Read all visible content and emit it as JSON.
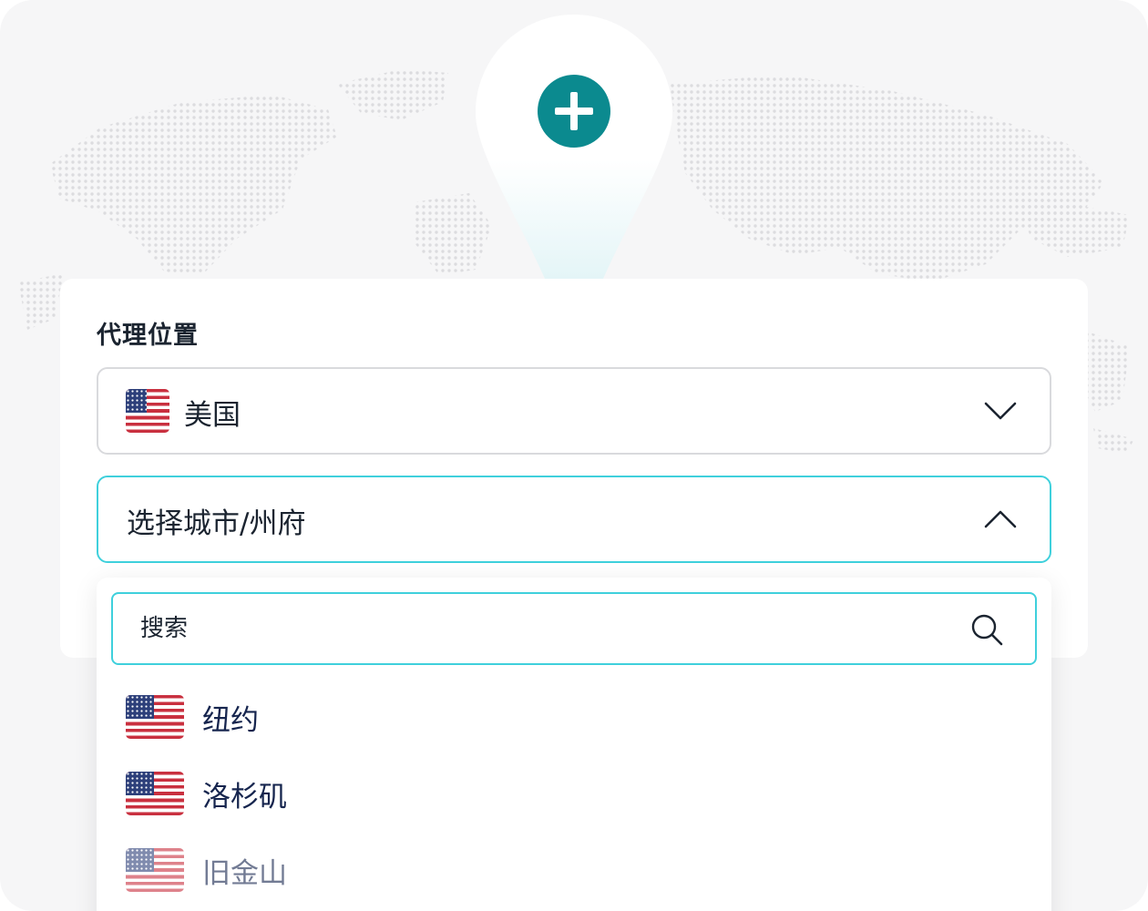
{
  "colors": {
    "accent": "#0b8a8f",
    "focus_border": "#3fd0dc",
    "text": "#1b2430",
    "list_text": "#16254e",
    "flag_red": "#c9303f",
    "flag_blue": "#2d3f7a"
  },
  "hero": {
    "pin_icon": "location-pin-icon",
    "add_icon": "plus-icon"
  },
  "form": {
    "label": "代理位置",
    "country_select": {
      "value": "美国",
      "flag_icon": "us-flag-icon",
      "chevron_icon": "chevron-down-icon"
    },
    "city_select": {
      "value": "选择城市/州府",
      "chevron_icon": "chevron-up-icon"
    }
  },
  "dropdown": {
    "search_placeholder": "搜索",
    "search_icon": "search-icon",
    "cities": [
      {
        "name": "纽约",
        "flag_icon": "us-flag-icon"
      },
      {
        "name": "洛杉矶",
        "flag_icon": "us-flag-icon"
      },
      {
        "name": "旧金山",
        "flag_icon": "us-flag-icon"
      }
    ]
  }
}
